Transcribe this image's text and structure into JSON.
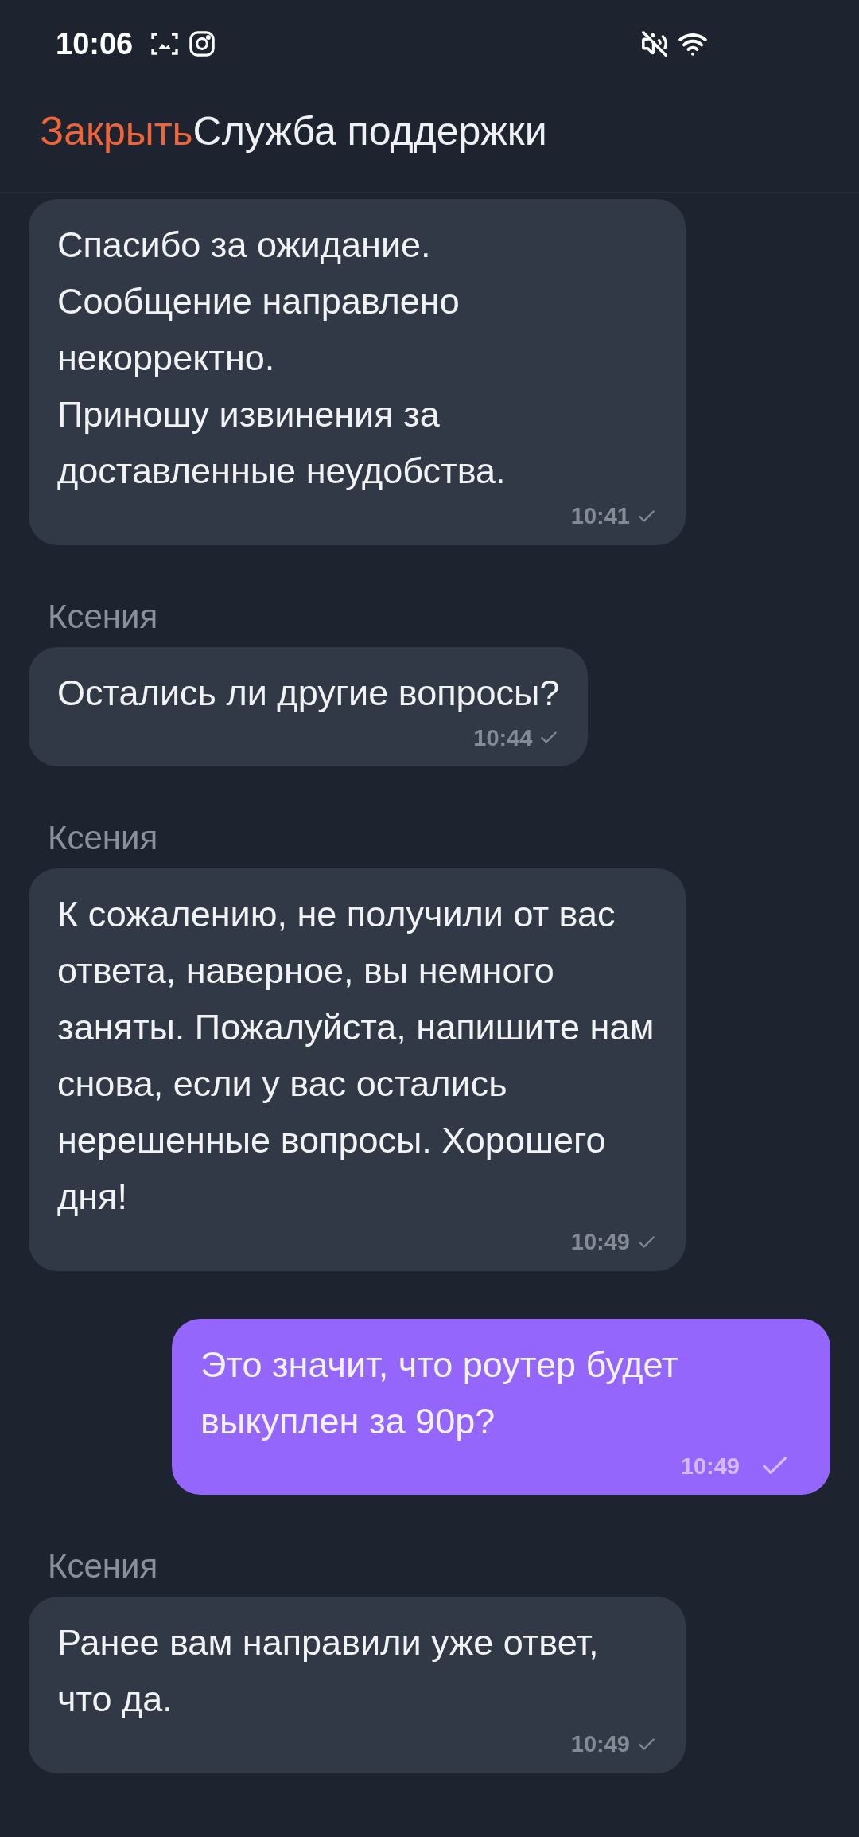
{
  "status_bar": {
    "time": "10:06"
  },
  "header": {
    "close_label": "Закрыть",
    "title": "Служба поддержки"
  },
  "messages": [
    {
      "kind": "incoming",
      "text": "Спасибо за ожидание.\nСообщение направлено некорректно.\nПриношу извинения за доставленные неудобства.",
      "time": "10:41",
      "read": true
    },
    {
      "kind": "incoming",
      "sender": "Ксения",
      "text": "Остались ли другие вопросы?",
      "time": "10:44",
      "read": true
    },
    {
      "kind": "incoming",
      "sender": "Ксения",
      "text": "К сожалению, не получили от вас ответа, наверное, вы немного заняты. Пожалуйста, напишите нам снова, если у вас остались нерешенные вопросы. Хорошего дня!",
      "time": "10:49",
      "read": true
    },
    {
      "kind": "outgoing",
      "text": "Это значит, что роутер будет выкуплен за 90р?",
      "time": "10:49",
      "read": true
    },
    {
      "kind": "incoming",
      "sender": "Ксения",
      "text": "Ранее вам направили уже ответ, что да.",
      "time": "10:49",
      "read": true
    }
  ]
}
